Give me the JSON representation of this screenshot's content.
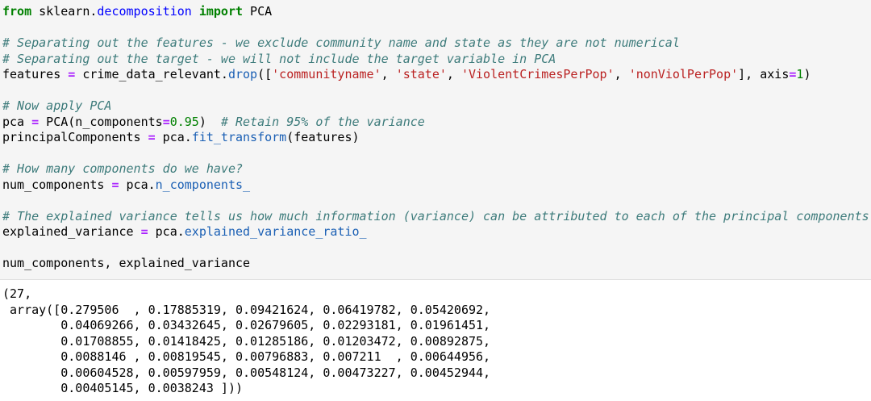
{
  "input_cell": {
    "lines": [
      {
        "parts": [
          {
            "t": "from",
            "c": "kw"
          },
          {
            "t": " ",
            "c": ""
          },
          {
            "t": "sklearn.",
            "c": ""
          },
          {
            "t": "decomposition",
            "c": "mod"
          },
          {
            "t": " ",
            "c": ""
          },
          {
            "t": "import",
            "c": "kw"
          },
          {
            "t": " PCA",
            "c": ""
          }
        ]
      },
      {
        "parts": []
      },
      {
        "parts": [
          {
            "t": "# Separating out the features - we exclude community name and state as they are not numerical",
            "c": "cm"
          }
        ]
      },
      {
        "parts": [
          {
            "t": "# Separating out the target - we will not include the target variable in PCA",
            "c": "cm"
          }
        ]
      },
      {
        "parts": [
          {
            "t": "features ",
            "c": ""
          },
          {
            "t": "=",
            "c": "op"
          },
          {
            "t": " crime_data_relevant.",
            "c": ""
          },
          {
            "t": "drop",
            "c": "at"
          },
          {
            "t": "([",
            "c": ""
          },
          {
            "t": "'communityname'",
            "c": "st"
          },
          {
            "t": ", ",
            "c": ""
          },
          {
            "t": "'state'",
            "c": "st"
          },
          {
            "t": ", ",
            "c": ""
          },
          {
            "t": "'ViolentCrimesPerPop'",
            "c": "st"
          },
          {
            "t": ", ",
            "c": ""
          },
          {
            "t": "'nonViolPerPop'",
            "c": "st"
          },
          {
            "t": "], axis",
            "c": ""
          },
          {
            "t": "=",
            "c": "op"
          },
          {
            "t": "1",
            "c": "nu"
          },
          {
            "t": ")",
            "c": ""
          }
        ]
      },
      {
        "parts": []
      },
      {
        "parts": [
          {
            "t": "# Now apply PCA",
            "c": "cm"
          }
        ]
      },
      {
        "parts": [
          {
            "t": "pca ",
            "c": ""
          },
          {
            "t": "=",
            "c": "op"
          },
          {
            "t": " PCA(n_components",
            "c": ""
          },
          {
            "t": "=",
            "c": "op"
          },
          {
            "t": "0.95",
            "c": "nu"
          },
          {
            "t": ")  ",
            "c": ""
          },
          {
            "t": "# Retain 95% of the variance",
            "c": "cm"
          }
        ]
      },
      {
        "parts": [
          {
            "t": "principalComponents ",
            "c": ""
          },
          {
            "t": "=",
            "c": "op"
          },
          {
            "t": " pca.",
            "c": ""
          },
          {
            "t": "fit_transform",
            "c": "at"
          },
          {
            "t": "(features)",
            "c": ""
          }
        ]
      },
      {
        "parts": []
      },
      {
        "parts": [
          {
            "t": "# How many components do we have?",
            "c": "cm"
          }
        ]
      },
      {
        "parts": [
          {
            "t": "num_components ",
            "c": ""
          },
          {
            "t": "=",
            "c": "op"
          },
          {
            "t": " pca.",
            "c": ""
          },
          {
            "t": "n_components_",
            "c": "at"
          }
        ]
      },
      {
        "parts": []
      },
      {
        "parts": [
          {
            "t": "# The explained variance tells us how much information (variance) can be attributed to each of the principal components",
            "c": "cm"
          }
        ]
      },
      {
        "parts": [
          {
            "t": "explained_variance ",
            "c": ""
          },
          {
            "t": "=",
            "c": "op"
          },
          {
            "t": " pca.",
            "c": ""
          },
          {
            "t": "explained_variance_ratio_",
            "c": "at"
          }
        ]
      },
      {
        "parts": []
      },
      {
        "parts": [
          {
            "t": "num_components, explained_variance",
            "c": ""
          }
        ]
      }
    ]
  },
  "output_cell": {
    "lines": [
      "(27,",
      " array([0.279506  , 0.17885319, 0.09421624, 0.06419782, 0.05420692,",
      "        0.04069266, 0.03432645, 0.02679605, 0.02293181, 0.01961451,",
      "        0.01708855, 0.01418425, 0.01285186, 0.01203472, 0.00892875,",
      "        0.0088146 , 0.00819545, 0.00796883, 0.007211  , 0.00644956,",
      "        0.00604528, 0.00597959, 0.00548124, 0.00473227, 0.00452944,",
      "        0.00405145, 0.0038243 ]))"
    ]
  },
  "colors": {
    "keyword": "#008000",
    "comment": "#3d7b7b",
    "string": "#ba2121",
    "number": "#008000",
    "operator": "#aa22ff",
    "module": "#0000ff",
    "attribute": "#1a5fb4",
    "input_bg": "#f5f5f5"
  }
}
